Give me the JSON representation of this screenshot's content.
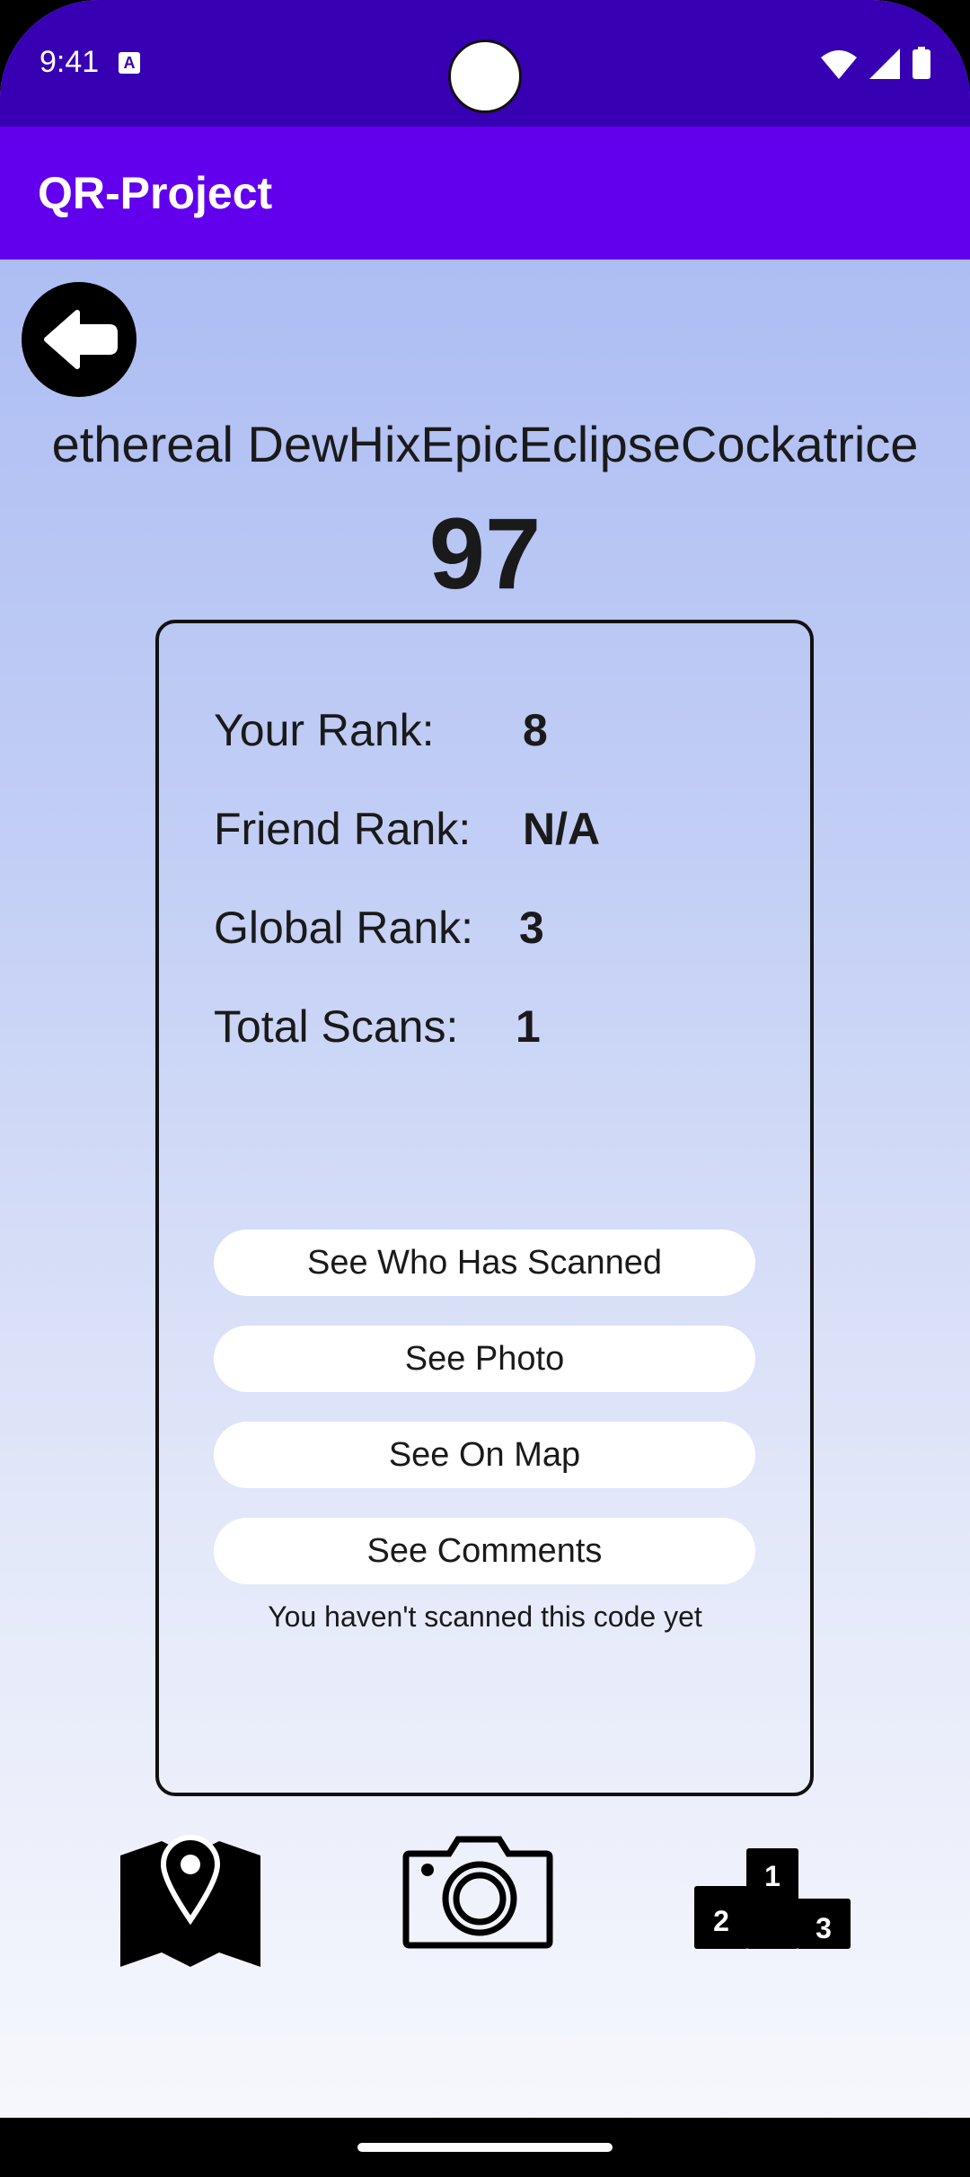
{
  "status_bar": {
    "time": "9:41",
    "notification_icon": "A"
  },
  "app_bar": {
    "title": "QR-Project"
  },
  "header": {
    "code_name": "ethereal DewHixEpicEclipseCockatrice",
    "score": "97"
  },
  "stats": [
    {
      "label": "Your Rank:",
      "value": "8"
    },
    {
      "label": "Friend Rank:",
      "value": "N/A"
    },
    {
      "label": "Global Rank:",
      "value": "3"
    },
    {
      "label": "Total Scans:",
      "value": "1"
    }
  ],
  "actions": {
    "who_scanned": "See Who Has Scanned",
    "photo": "See Photo",
    "map": "See On Map",
    "comments": "See Comments"
  },
  "hint": "You haven't scanned this code yet",
  "bottom_nav": [
    "map-icon",
    "camera-icon",
    "leaderboard-podium-icon"
  ],
  "podium_labels": [
    "1",
    "2",
    "3"
  ]
}
